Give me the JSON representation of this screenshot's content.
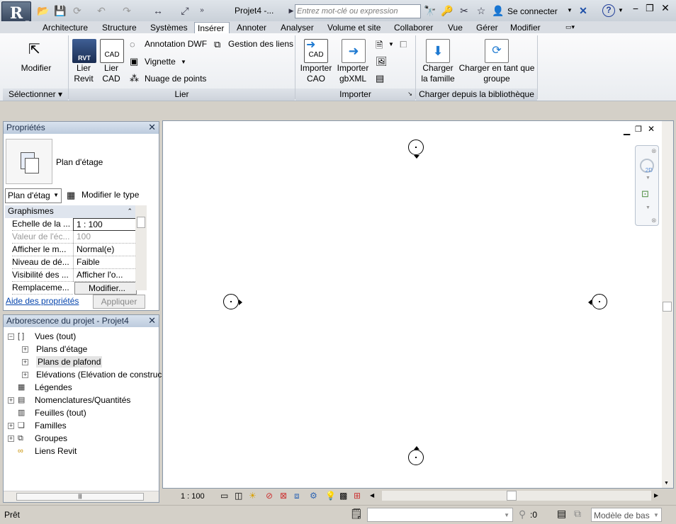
{
  "title_bar": {
    "doc_title": "Projet4 -...",
    "search_placeholder": "Entrez mot-clé ou expression",
    "sign_in": "Se connecter",
    "help": "?"
  },
  "tabs": [
    "Architecture",
    "Structure",
    "Systèmes",
    "Insérer",
    "Annoter",
    "Analyser",
    "Volume et site",
    "Collaborer",
    "Vue",
    "Gérer",
    "Modifier"
  ],
  "active_tab": "Insérer",
  "ribbon": {
    "modify": "Modifier",
    "link_revit": [
      "Lier",
      "Revit"
    ],
    "link_cad": [
      "Lier",
      "CAD"
    ],
    "dwf": "Annotation DWF",
    "decal": "Vignette",
    "point_cloud": "Nuage de points",
    "manage_links": "Gestion des liens",
    "import_cad": [
      "Importer",
      "CAO"
    ],
    "import_gbxml": [
      "Importer",
      "gbXML"
    ],
    "load_family": [
      "Charger",
      "la famille"
    ],
    "load_group": [
      "Charger en tant que",
      "groupe"
    ],
    "panels": [
      "Sélectionner",
      "Lier",
      "Importer",
      "Charger depuis la bibliothèque"
    ]
  },
  "properties": {
    "title": "Propriétés",
    "type_name": "Plan d'étage",
    "type_dropdown": "Plan d'étag",
    "edit_type": "Modifier le type",
    "section": "Graphismes",
    "rows": [
      [
        "Echelle de la ...",
        "1 : 100"
      ],
      [
        "Valeur de l'éc...",
        "100"
      ],
      [
        "Afficher le m...",
        "Normal(e)"
      ],
      [
        "Niveau de dé...",
        "Faible"
      ],
      [
        "Visibilité des ...",
        "Afficher l'o..."
      ],
      [
        "Remplaceme...",
        "Modifier..."
      ]
    ],
    "help_link": "Aide des propriétés",
    "apply": "Appliquer"
  },
  "project_browser": {
    "title": "Arborescence du projet - Projet4",
    "items": [
      "Vues (tout)",
      "Plans d'étage",
      "Plans de plafond",
      "Elévations (Elévation de construc",
      "Légendes",
      "Nomenclatures/Quantités",
      "Feuilles (tout)",
      "Familles",
      "Groupes",
      "Liens Revit"
    ]
  },
  "view": {
    "scale": "1 : 100"
  },
  "status": {
    "text": "Prêt",
    "selection_count": ":0",
    "model": "Modèle de bas"
  }
}
